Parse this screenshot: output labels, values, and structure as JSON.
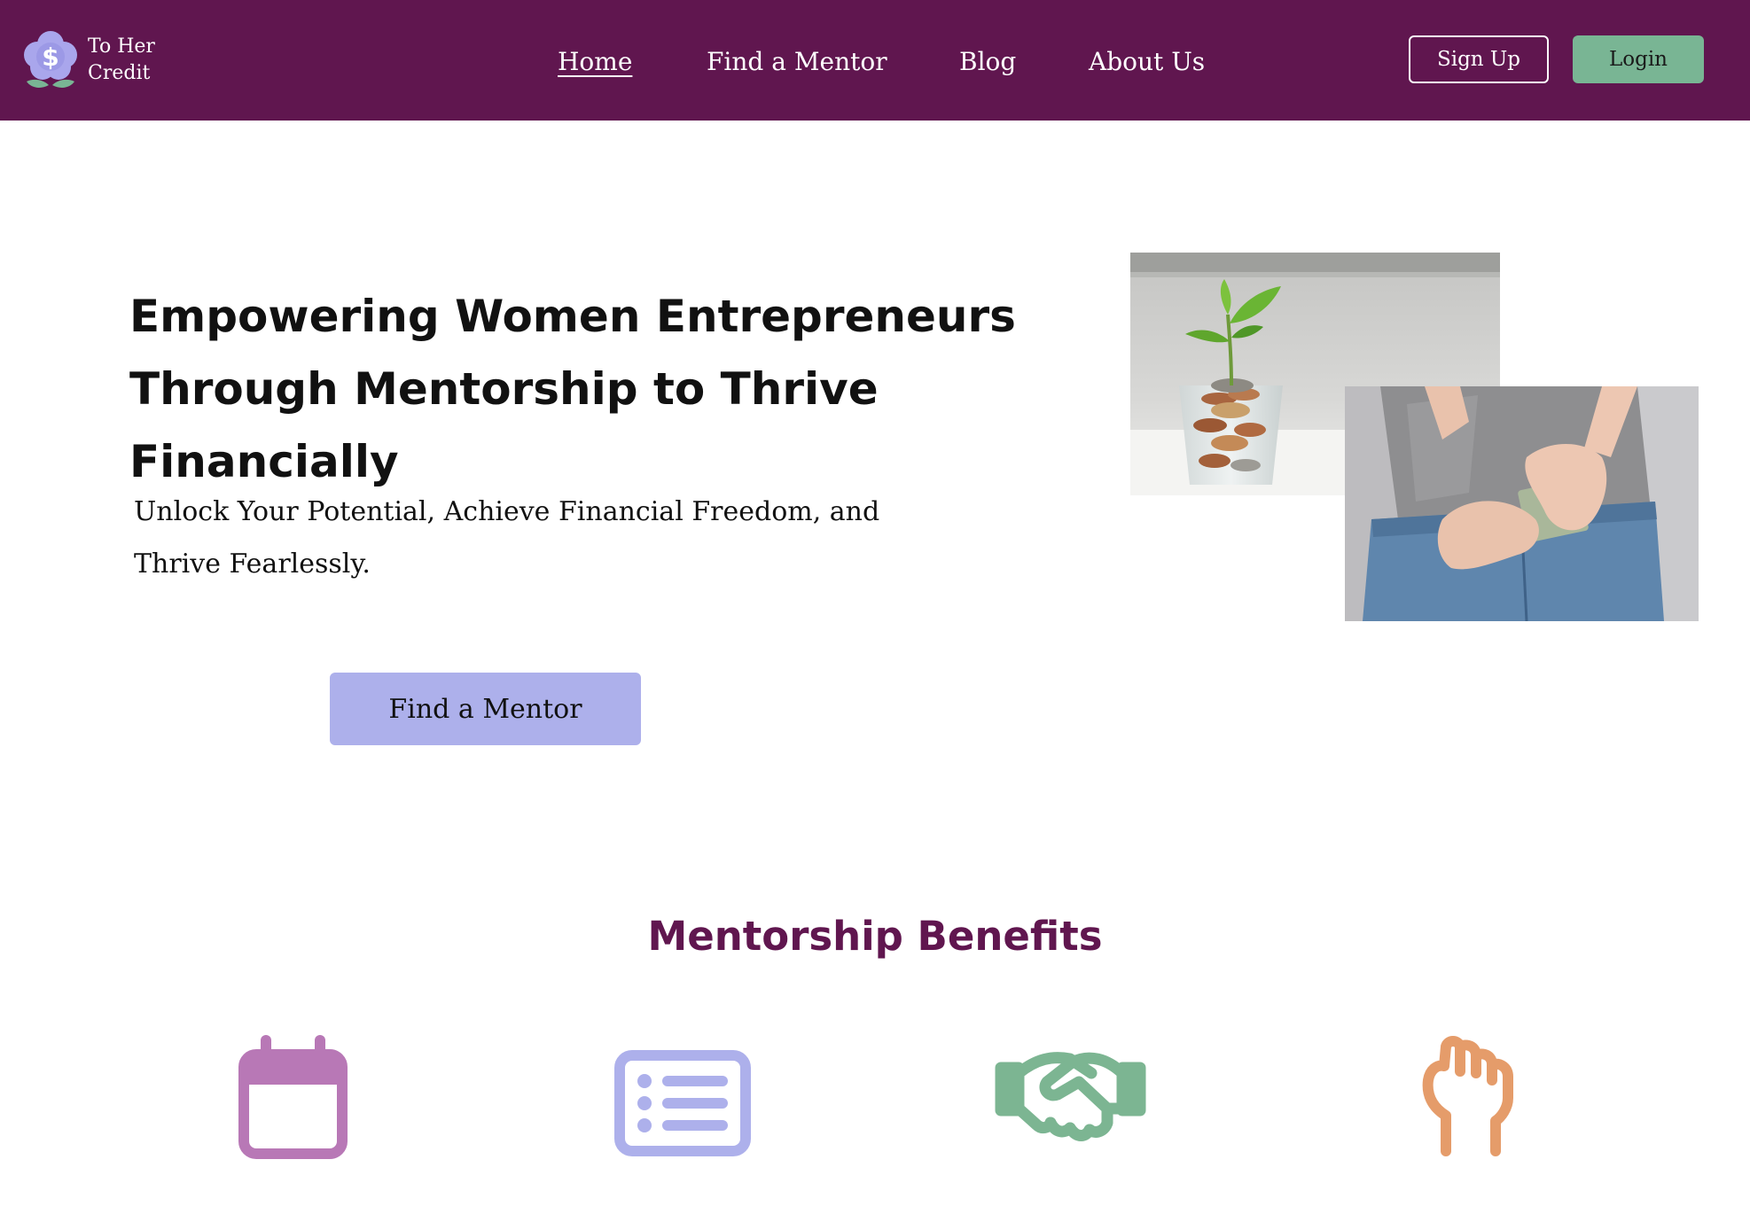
{
  "brand": {
    "line1": "To Her",
    "line2": "Credit",
    "logo_icon": "flower-dollar-icon"
  },
  "nav": {
    "items": [
      {
        "label": "Home",
        "active": true
      },
      {
        "label": "Find a Mentor",
        "active": false
      },
      {
        "label": "Blog",
        "active": false
      },
      {
        "label": "About Us",
        "active": false
      }
    ],
    "signup_label": "Sign Up",
    "login_label": "Login"
  },
  "hero": {
    "title_line1": "Empowering Women Entrepreneurs",
    "title_line2": "Through Mentorship to Thrive Financially",
    "subtitle_line1": "Unlock Your Potential, Achieve Financial Freedom, and",
    "subtitle_line2": "Thrive Fearlessly.",
    "cta_label": "Find a Mentor",
    "images": [
      "plant-in-coin-jar-photo",
      "cash-in-jeans-pocket-photo"
    ]
  },
  "benefits": {
    "title": "Mentorship Benefits",
    "icons": [
      "calendar-icon",
      "list-icon",
      "handshake-icon",
      "raised-fist-icon"
    ]
  },
  "colors": {
    "header_bg": "#60164f",
    "login_bg": "#79b594",
    "cta_bg": "#adb0eb",
    "section_title": "#60164f",
    "calendar": "#b878b6",
    "list": "#adb0eb",
    "handshake": "#7cb592",
    "fist": "#e59c6a"
  }
}
